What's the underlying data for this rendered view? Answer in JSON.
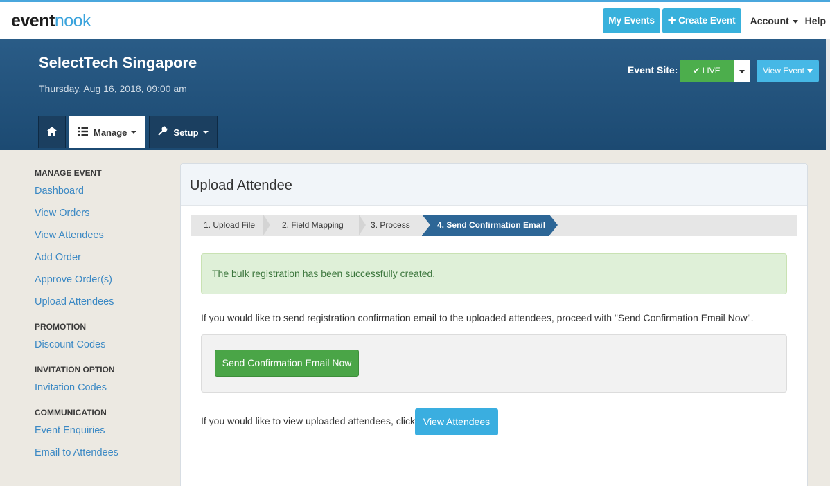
{
  "app": {
    "logo_part1": "event",
    "logo_part2": "nook"
  },
  "topnav": {
    "my_events": "My Events",
    "create_event": "Create Event",
    "account": "Account",
    "help": "Help"
  },
  "event": {
    "title": "SelectTech Singapore",
    "date": "Thursday, Aug 16, 2018, 09:00 am",
    "site_label": "Event Site:",
    "live_label": "LIVE",
    "view_event": "View Event"
  },
  "tabs": {
    "manage": "Manage",
    "setup": "Setup"
  },
  "sidebar": {
    "sections": [
      {
        "heading": "MANAGE EVENT",
        "items": [
          "Dashboard",
          "View Orders",
          "View Attendees",
          "Add Order",
          "Approve Order(s)",
          "Upload Attendees"
        ]
      },
      {
        "heading": "PROMOTION",
        "items": [
          "Discount Codes"
        ]
      },
      {
        "heading": "INVITATION OPTION",
        "items": [
          "Invitation Codes"
        ]
      },
      {
        "heading": "COMMUNICATION",
        "items": [
          "Event Enquiries",
          "Email to Attendees"
        ]
      }
    ]
  },
  "main": {
    "title": "Upload Attendee",
    "steps": [
      "1. Upload File",
      "2. Field Mapping",
      "3. Process",
      "4. Send Confirmation Email"
    ],
    "active_step": 4,
    "success_message": "The bulk registration has been successfully created.",
    "intro_text": "If you would like to send registration confirmation email to the uploaded attendees, proceed with \"Send Confirmation Email Now\".",
    "send_button": "Send Confirmation Email Now",
    "view_text": "If you would like to view uploaded attendees, click",
    "view_button": "View Attendees"
  },
  "colors": {
    "accent": "#38b1dc",
    "header_bg": "#1c4a72",
    "success": "#4aa547",
    "step_active": "#2d6696",
    "link": "#3c89c4"
  }
}
